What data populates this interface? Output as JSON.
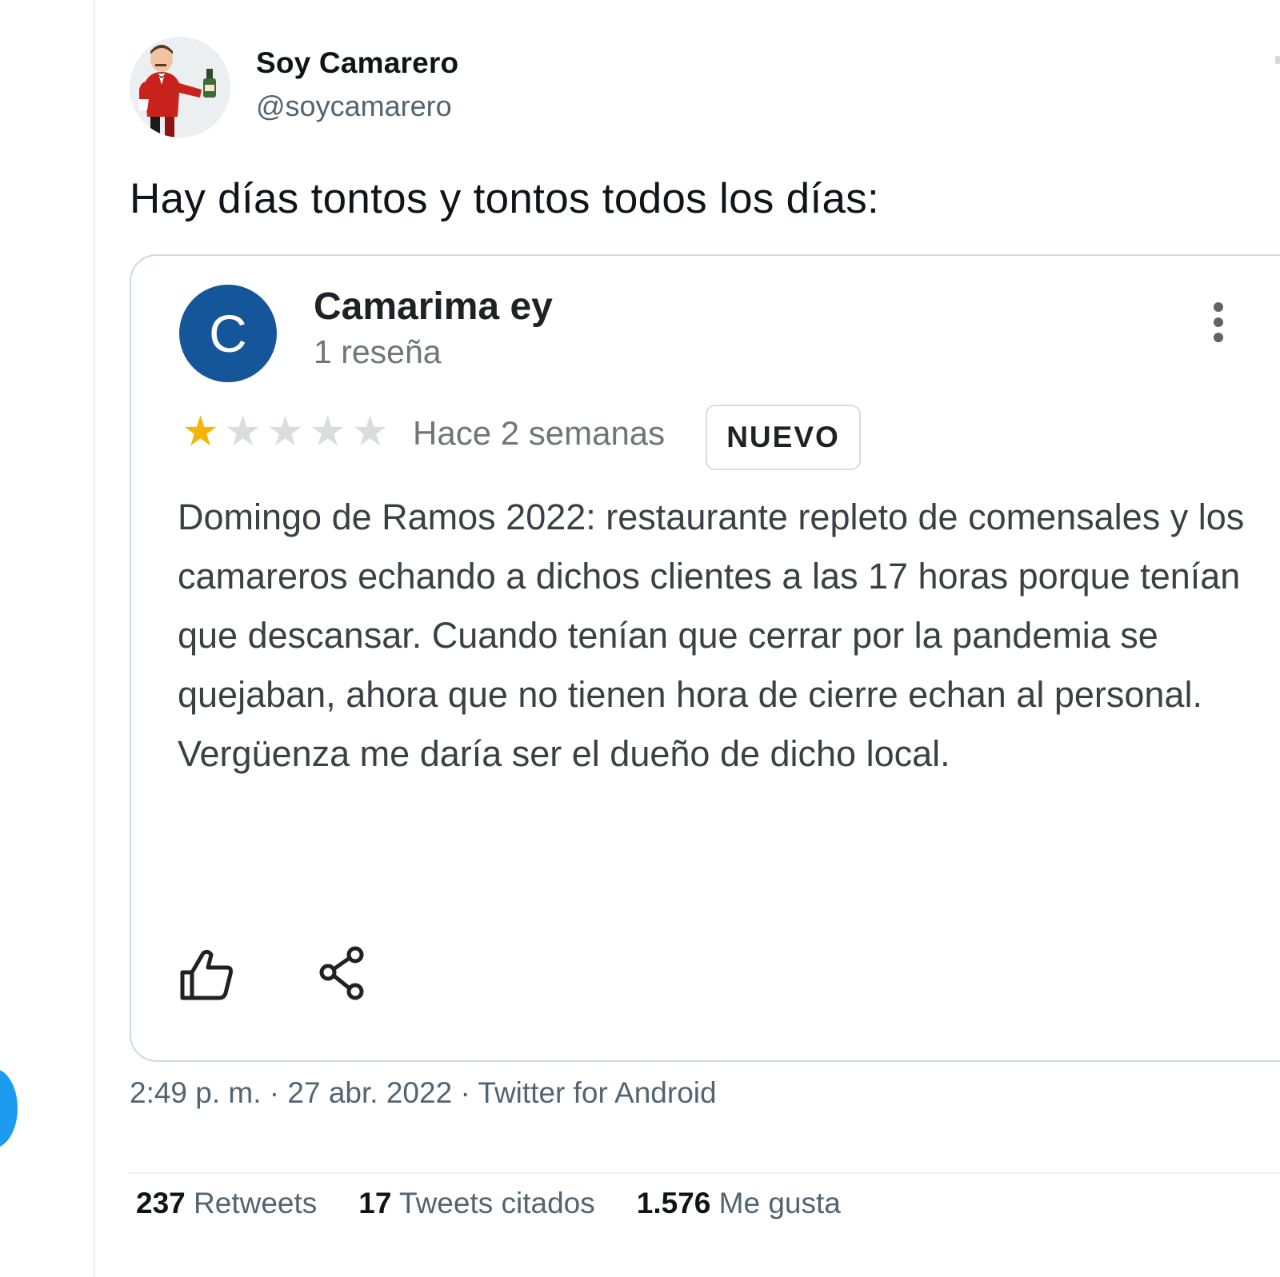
{
  "tweet": {
    "author_name": "Soy Camarero",
    "author_handle": "@soycamarero",
    "text": "Hay días tontos y tontos todos los días:",
    "meta": {
      "time": "2:49 p. m.",
      "dot1": " · ",
      "date": "27 abr. 2022",
      "dot2": " · ",
      "source": "Twitter for Android"
    },
    "stats": {
      "retweets_count": "237",
      "retweets_label": "Retweets",
      "quotes_count": "17",
      "quotes_label": "Tweets citados",
      "likes_count": "1.576",
      "likes_label": "Me gusta"
    }
  },
  "review": {
    "avatar_letter": "C",
    "avatar_color": "#15569a",
    "reviewer_name": "Camarima ey",
    "review_count": "1 reseña",
    "rating": 1,
    "rating_max": 5,
    "star_color": "#f5b400",
    "date": "Hace 2 semanas",
    "badge": "NUEVO",
    "body": "Domingo de Ramos 2022: restaurante repleto de comensales y los camareros echando a dichos clientes a las 17 horas porque tenían que descansar. Cuando tenían que cerrar por la pandemia se quejaban, ahora que no tienen hora de cierre echan al personal. Vergüenza me daría ser el dueño de dicho local.",
    "icons": {
      "menu": "more-vert-icon",
      "like": "thumb-up-icon",
      "share": "share-icon"
    }
  },
  "accent_color": "#1d9bf0"
}
